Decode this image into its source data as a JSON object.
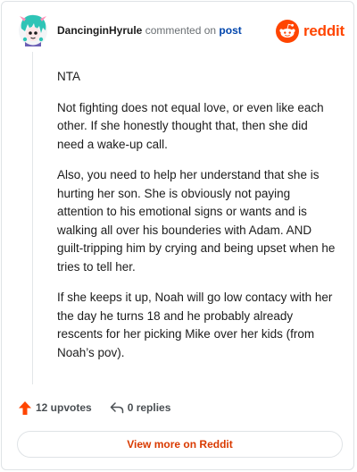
{
  "header": {
    "username": "DancinginHyrule",
    "verb": " commented on ",
    "post_link": "post",
    "brand": "reddit"
  },
  "comment": {
    "paragraphs": [
      "NTA",
      "Not fighting does not equal love, or even like each other. If she honestly thought that, then she did need a wake-up call.",
      "Also, you need to help her understand that she is hurting her son. She is obviously not paying attention to his emotional signs or wants and is walking all over his bounderies with Adam. AND guilt-tripping him by crying and being upset when he tries to tell her.",
      "If she keeps it up, Noah will go low contacy with her the day he turns 18 and he probably already rescents for her picking Mike over her kids (from Noah’s pov)."
    ]
  },
  "actions": {
    "upvotes": "12 upvotes",
    "replies": "0 replies"
  },
  "footer": {
    "view_more": "View more on Reddit"
  },
  "colors": {
    "brand": "#ff4500",
    "link": "#0045ac",
    "upvote": "#ff4500",
    "view_more_text": "#d93a00"
  },
  "icons": [
    "avatar",
    "reddit-logo-icon",
    "upvote-arrow-icon",
    "reply-icon"
  ]
}
